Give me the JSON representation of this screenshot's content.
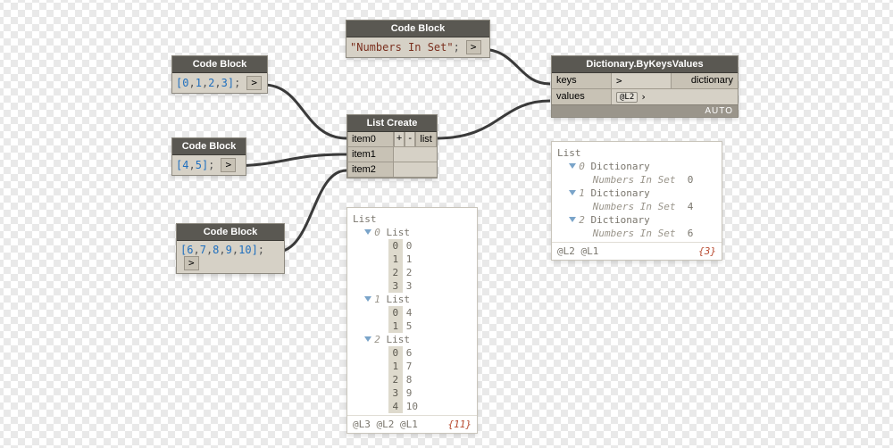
{
  "nodes": {
    "cb1": {
      "title": "Code Block",
      "code_html": "<span class='br'>[</span><span class='num'>0</span><span class='sep'>,</span><span class='num'>1</span><span class='sep'>,</span><span class='num'>2</span><span class='sep'>,</span><span class='num'>3</span><span class='br'>]</span><span class='semi'>;</span>",
      "chev": ">"
    },
    "cb2": {
      "title": "Code Block",
      "code_html": "<span class='br'>[</span><span class='num'>4</span><span class='sep'>,</span><span class='num'>5</span><span class='br'>]</span><span class='semi'>;</span>",
      "chev": ">"
    },
    "cb3": {
      "title": "Code Block",
      "code_html": "<span class='br'>[</span><span class='num'>6</span><span class='sep'>,</span><span class='num'>7</span><span class='sep'>,</span><span class='num'>8</span><span class='sep'>,</span><span class='num'>9</span><span class='sep'>,</span><span class='num'>10</span><span class='br'>]</span><span class='semi'>;</span>",
      "chev": ">"
    },
    "cbK": {
      "title": "Code Block",
      "code_html": "<span class='str'>\"Numbers In Set\"</span><span class='semi'>;</span>",
      "chev": ">"
    },
    "listCreate": {
      "title": "List Create",
      "ports": [
        "item0",
        "item1",
        "item2"
      ],
      "plus": "+",
      "minus": "-",
      "out": "list"
    },
    "dict": {
      "title": "Dictionary.ByKeysValues",
      "keys_label": "keys",
      "values_label": "values",
      "values_lacing": "@L2",
      "out_label": "dictionary",
      "footer": "AUTO"
    }
  },
  "watch_list": {
    "header": "List",
    "groups": [
      {
        "idx": "0",
        "label": "List",
        "items": [
          [
            "0",
            "0"
          ],
          [
            "1",
            "1"
          ],
          [
            "2",
            "2"
          ],
          [
            "3",
            "3"
          ]
        ]
      },
      {
        "idx": "1",
        "label": "List",
        "items": [
          [
            "0",
            "4"
          ],
          [
            "1",
            "5"
          ]
        ]
      },
      {
        "idx": "2",
        "label": "List",
        "items": [
          [
            "0",
            "6"
          ],
          [
            "1",
            "7"
          ],
          [
            "2",
            "8"
          ],
          [
            "3",
            "9"
          ],
          [
            "4",
            "10"
          ]
        ]
      }
    ],
    "levels": "@L3 @L2 @L1",
    "count": "{11}"
  },
  "watch_dict": {
    "header": "List",
    "groups": [
      {
        "idx": "0",
        "label": "Dictionary",
        "items": [
          [
            "Numbers In Set",
            "0"
          ]
        ]
      },
      {
        "idx": "1",
        "label": "Dictionary",
        "items": [
          [
            "Numbers In Set",
            "4"
          ]
        ]
      },
      {
        "idx": "2",
        "label": "Dictionary",
        "items": [
          [
            "Numbers In Set",
            "6"
          ]
        ]
      }
    ],
    "levels": "@L2 @L1",
    "count": "{3}"
  }
}
